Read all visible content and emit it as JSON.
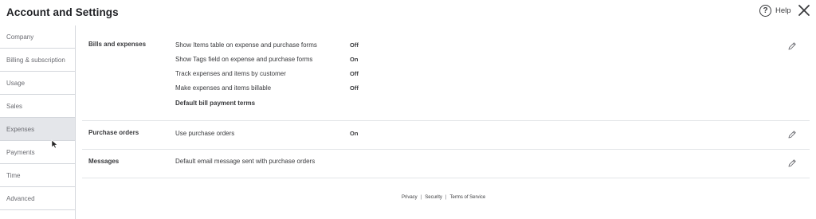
{
  "header": {
    "title": "Account and Settings",
    "help_label": "Help",
    "help_icon": "help-circle-icon",
    "close_icon": "close-icon"
  },
  "sidebar": {
    "items": [
      {
        "label": "Company",
        "active": false
      },
      {
        "label": "Billing & subscription",
        "active": false
      },
      {
        "label": "Usage",
        "active": false
      },
      {
        "label": "Sales",
        "active": false
      },
      {
        "label": "Expenses",
        "active": true
      },
      {
        "label": "Payments",
        "active": false
      },
      {
        "label": "Time",
        "active": false
      },
      {
        "label": "Advanced",
        "active": false
      }
    ]
  },
  "sections": {
    "bills": {
      "title": "Bills and expenses",
      "rows": [
        {
          "label": "Show Items table on expense and purchase forms",
          "value": "Off"
        },
        {
          "label": "Show Tags field on expense and purchase forms",
          "value": "On"
        },
        {
          "label": "Track expenses and items by customer",
          "value": "Off"
        },
        {
          "label": "Make expenses and items billable",
          "value": "Off"
        },
        {
          "label": "Default bill payment terms",
          "value": ""
        }
      ]
    },
    "purchase_orders": {
      "title": "Purchase orders",
      "rows": [
        {
          "label": "Use purchase orders",
          "value": "On"
        }
      ]
    },
    "messages": {
      "title": "Messages",
      "rows": [
        {
          "label": "Default email message sent with purchase orders",
          "value": ""
        }
      ]
    }
  },
  "footer": {
    "privacy": "Privacy",
    "security": "Security",
    "terms": "Terms of Service",
    "separator": "|"
  }
}
